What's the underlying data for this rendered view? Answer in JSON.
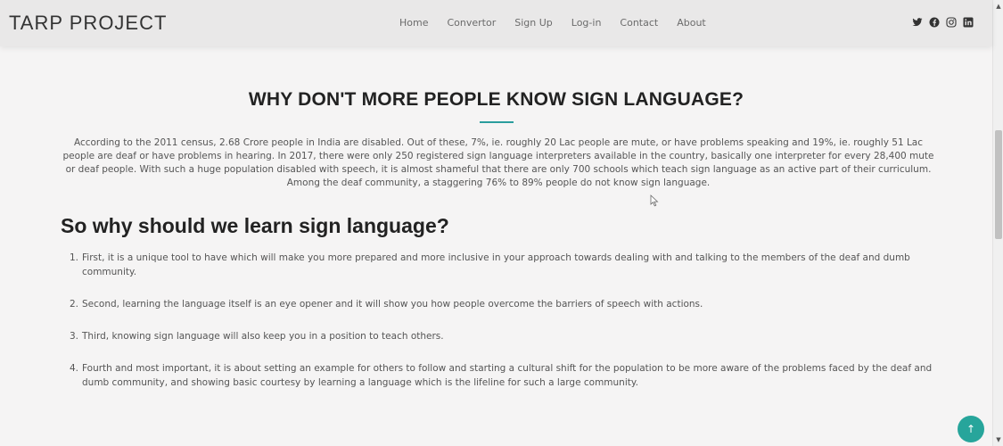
{
  "header": {
    "logo": "TARP PROJECT",
    "nav": [
      "Home",
      "Convertor",
      "Sign Up",
      "Log-in",
      "Contact",
      "About"
    ],
    "social": [
      "twitter-icon",
      "facebook-icon",
      "instagram-icon",
      "linkedin-icon"
    ]
  },
  "main": {
    "title": "WHY DON'T MORE PEOPLE KNOW SIGN LANGUAGE?",
    "intro": "According to the 2011 census, 2.68 Crore people in India are disabled. Out of these, 7%, ie. roughly 20 Lac people are mute, or have problems speaking and 19%, ie. roughly 51 Lac people are deaf or have problems in hearing. In 2017, there were only 250 registered sign language interpreters available in the country, basically one interpreter for every 28,400 mute or deaf people. With such a huge population disabled with speech, it is almost shameful that there are only 700 schools which teach sign language as an active part of their curriculum. Among the deaf community, a staggering 76% to 89% people do not know sign language.",
    "subtitle": "So why should we learn sign language?",
    "reasons": [
      {
        "num": "1.",
        "text": "First, it is a unique tool to have which will make you more prepared and more inclusive in your approach towards dealing with and talking to the members of the deaf and dumb community."
      },
      {
        "num": "2.",
        "text": "Second, learning the language itself is an eye opener and it will show you how people overcome the barriers of speech with actions."
      },
      {
        "num": "3.",
        "text": "Third, knowing sign language will also keep you in a position to teach others."
      },
      {
        "num": "4.",
        "text": "Fourth and most important, it is about setting an example for others to follow and starting a cultural shift for the population to be more aware of the problems faced by the deaf and dumb community, and showing basic courtesy by learning a language which is the lifeline for such a large community."
      }
    ]
  },
  "back_to_top": "↑",
  "colors": {
    "accent": "#27a59b",
    "rule": "#2a9d9d"
  }
}
